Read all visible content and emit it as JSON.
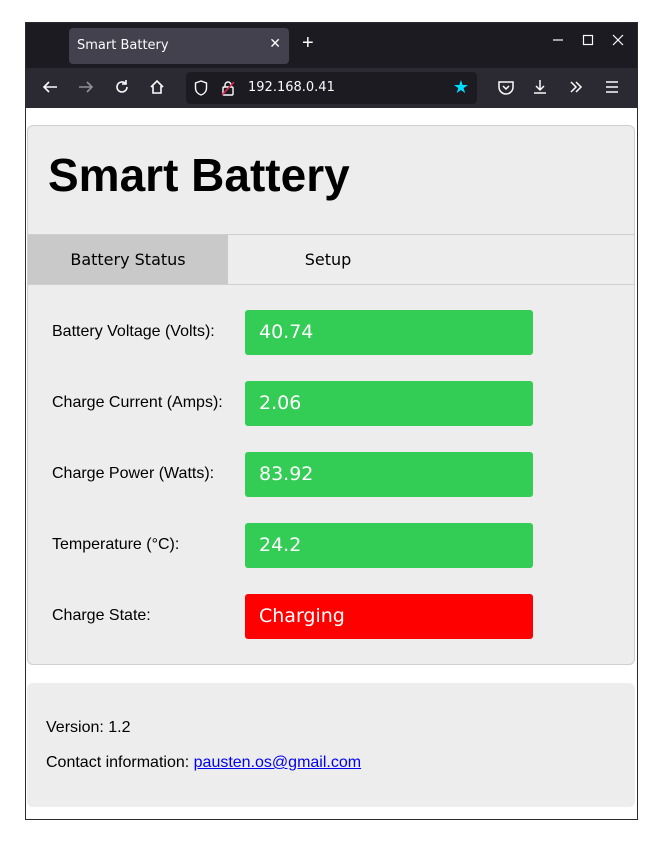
{
  "browser": {
    "tab_title": "Smart Battery",
    "tab_close": "✕",
    "new_tab": "+",
    "url": "192.168.0.41",
    "window_controls": {
      "minimize": "—",
      "maximize": "☐",
      "close": "✕"
    }
  },
  "page": {
    "title": "Smart Battery",
    "tabs": [
      {
        "label": "Battery Status",
        "active": true
      },
      {
        "label": "Setup",
        "active": false
      }
    ],
    "readings": [
      {
        "label": "Battery Voltage (Volts):",
        "value": "40.74",
        "color": "#33cc55"
      },
      {
        "label": "Charge Current (Amps):",
        "value": "2.06",
        "color": "#33cc55"
      },
      {
        "label": "Charge Power (Watts):",
        "value": "83.92",
        "color": "#33cc55"
      },
      {
        "label": "Temperature (°C):",
        "value": "24.2",
        "color": "#33cc55"
      },
      {
        "label": "Charge State:",
        "value": "Charging",
        "color": "#ff0000"
      }
    ],
    "footer": {
      "version": "Version: 1.2",
      "contact_label": "Contact information:",
      "email": "pausten.os@gmail.com"
    }
  }
}
